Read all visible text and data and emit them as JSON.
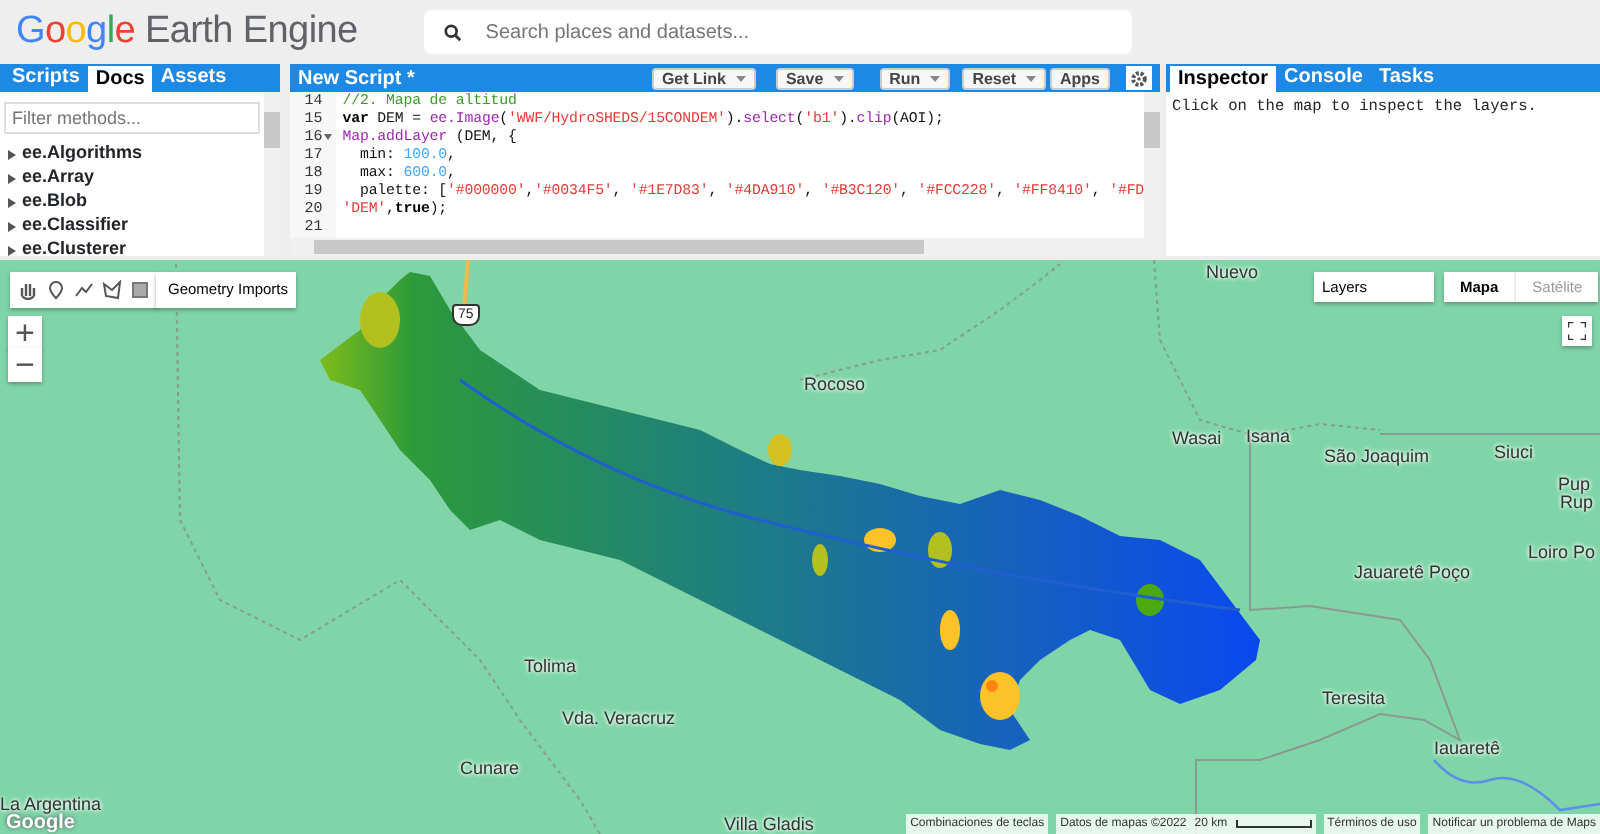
{
  "header": {
    "logo": {
      "brand": "Google",
      "product": "Earth Engine"
    },
    "search": {
      "placeholder": "Search places and datasets..."
    }
  },
  "left_panel": {
    "tabs": [
      {
        "label": "Scripts",
        "selected": false
      },
      {
        "label": "Docs",
        "selected": true
      },
      {
        "label": "Assets",
        "selected": false
      }
    ],
    "filter": {
      "placeholder": "Filter methods..."
    },
    "items": [
      {
        "label": "ee.Algorithms"
      },
      {
        "label": "ee.Array"
      },
      {
        "label": "ee.Blob"
      },
      {
        "label": "ee.Classifier"
      },
      {
        "label": "ee.Clusterer"
      }
    ]
  },
  "editor": {
    "title": "New Script *",
    "buttons": [
      {
        "label": "Get Link",
        "dropdown": true
      },
      {
        "label": "Save",
        "dropdown": true
      },
      {
        "label": "Run",
        "dropdown": true
      },
      {
        "label": "Reset",
        "dropdown": true
      },
      {
        "label": "Apps",
        "dropdown": false
      }
    ],
    "lines": [
      {
        "number": "14",
        "fold": false,
        "tokens": [
          {
            "kind": "comment",
            "text": "//2. Mapa de altitud"
          }
        ]
      },
      {
        "number": "15",
        "fold": false,
        "tokens": [
          {
            "kind": "keyword",
            "text": "var"
          },
          {
            "kind": "plain",
            "text": " DEM = "
          },
          {
            "kind": "function",
            "text": "ee.Image"
          },
          {
            "kind": "plain",
            "text": "("
          },
          {
            "kind": "string",
            "text": "'WWF/HydroSHEDS/15CONDEM'"
          },
          {
            "kind": "plain",
            "text": ")."
          },
          {
            "kind": "function",
            "text": "select"
          },
          {
            "kind": "plain",
            "text": "("
          },
          {
            "kind": "string",
            "text": "'b1'"
          },
          {
            "kind": "plain",
            "text": ")."
          },
          {
            "kind": "function",
            "text": "clip"
          },
          {
            "kind": "plain",
            "text": "(AOI);"
          }
        ]
      },
      {
        "number": "16",
        "fold": true,
        "tokens": [
          {
            "kind": "function",
            "text": "Map.addLayer"
          },
          {
            "kind": "plain",
            "text": " (DEM, {"
          }
        ]
      },
      {
        "number": "17",
        "fold": false,
        "tokens": [
          {
            "kind": "plain",
            "text": "  min: "
          },
          {
            "kind": "number",
            "text": "100.0"
          },
          {
            "kind": "plain",
            "text": ","
          }
        ]
      },
      {
        "number": "18",
        "fold": false,
        "tokens": [
          {
            "kind": "plain",
            "text": "  max: "
          },
          {
            "kind": "number",
            "text": "600.0"
          },
          {
            "kind": "plain",
            "text": ","
          }
        ]
      },
      {
        "number": "19",
        "fold": false,
        "tokens": [
          {
            "kind": "plain",
            "text": "  palette: ["
          },
          {
            "kind": "string",
            "text": "'#000000'"
          },
          {
            "kind": "plain",
            "text": ","
          },
          {
            "kind": "string",
            "text": "'#0034F5'"
          },
          {
            "kind": "plain",
            "text": ", "
          },
          {
            "kind": "string",
            "text": "'#1E7D83'"
          },
          {
            "kind": "plain",
            "text": ", "
          },
          {
            "kind": "string",
            "text": "'#4DA910'"
          },
          {
            "kind": "plain",
            "text": ", "
          },
          {
            "kind": "string",
            "text": "'#B3C120'"
          },
          {
            "kind": "plain",
            "text": ", "
          },
          {
            "kind": "string",
            "text": "'#FCC228'"
          },
          {
            "kind": "plain",
            "text": ", "
          },
          {
            "kind": "string",
            "text": "'#FF8410'"
          },
          {
            "kind": "plain",
            "text": ", "
          },
          {
            "kind": "string",
            "text": "'#FD"
          }
        ]
      },
      {
        "number": "20",
        "fold": false,
        "tokens": [
          {
            "kind": "string",
            "text": "'DEM'"
          },
          {
            "kind": "plain",
            "text": ","
          },
          {
            "kind": "keyword",
            "text": "true"
          },
          {
            "kind": "plain",
            "text": ");"
          }
        ]
      },
      {
        "number": "21",
        "fold": false
      }
    ]
  },
  "right_panel": {
    "tabs": [
      {
        "label": "Inspector",
        "selected": true
      },
      {
        "label": "Console",
        "selected": false
      },
      {
        "label": "Tasks",
        "selected": false
      }
    ],
    "message": "Click on the map to inspect the layers."
  },
  "map": {
    "geometry_imports": "Geometry Imports",
    "zoom_in": "+",
    "zoom_out": "−",
    "layers": "Layers",
    "map_types": [
      {
        "label": "Mapa",
        "selected": true
      },
      {
        "label": "Satélite",
        "selected": false
      }
    ],
    "route_shield": "75",
    "places": [
      {
        "text": "Nuevo"
      },
      {
        "text": "Rocoso"
      },
      {
        "text": "Wasai"
      },
      {
        "text": "Isana"
      },
      {
        "text": "São Joaquim"
      },
      {
        "text": "Siuci"
      },
      {
        "text": "Pup"
      },
      {
        "text": "Rup"
      },
      {
        "text": "Loiro Po"
      },
      {
        "text": "Jauaretê Poço"
      },
      {
        "text": "Tolima"
      },
      {
        "text": "Vda. Veracruz"
      },
      {
        "text": "Teresita"
      },
      {
        "text": "Iauaretê"
      },
      {
        "text": "Cunare"
      },
      {
        "text": "La Argentina"
      },
      {
        "text": "Villa Gladis"
      }
    ],
    "google_logo": "Google",
    "footer": {
      "shortcuts": "Combinaciones de teclas",
      "data": "Datos de mapas ©2022",
      "scale": "20 km",
      "terms": "Términos de uso",
      "report": "Notificar un problema de Maps"
    }
  }
}
